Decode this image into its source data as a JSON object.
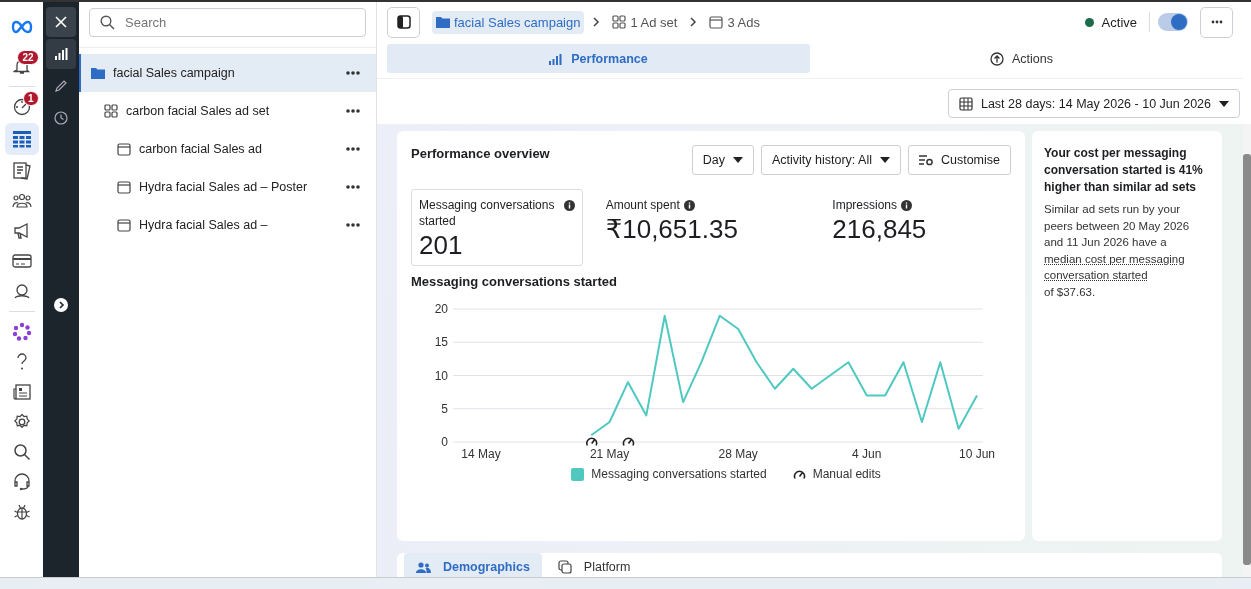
{
  "rail": [
    {
      "kind": "logo",
      "selected": false
    },
    {
      "kind": "bell",
      "selected": false,
      "badge": "22"
    },
    {
      "kind": "gauge",
      "selected": false,
      "badge": "1"
    },
    {
      "kind": "table",
      "selected": true
    },
    {
      "kind": "pages",
      "selected": false
    },
    {
      "kind": "people",
      "selected": false
    },
    {
      "kind": "megaphone",
      "selected": false
    },
    {
      "kind": "card",
      "selected": false
    },
    {
      "kind": "person",
      "selected": false
    },
    {
      "kind": "flower",
      "selected": false
    },
    {
      "kind": "help",
      "selected": false
    },
    {
      "kind": "news",
      "selected": false
    },
    {
      "kind": "settings",
      "selected": false
    },
    {
      "kind": "search",
      "selected": false
    },
    {
      "kind": "headset",
      "selected": false
    },
    {
      "kind": "bug",
      "selected": false
    }
  ],
  "tools": [
    {
      "kind": "chart",
      "selected": true
    },
    {
      "kind": "pencil",
      "selected": false
    },
    {
      "kind": "clock",
      "selected": false
    }
  ],
  "tree": {
    "search": {
      "placeholder": "Search"
    },
    "items": [
      {
        "kind": "campaign",
        "label": "facial Sales campaign",
        "selected": true,
        "children": [
          {
            "kind": "adset",
            "label": "carbon facial Sales ad set",
            "selected": false,
            "children": [
              {
                "kind": "ad",
                "label": "carbon facial Sales ad",
                "selected": false
              },
              {
                "kind": "ad",
                "label": "Hydra facial Sales ad – Poster",
                "selected": false
              },
              {
                "kind": "ad",
                "label": "Hydra facial Sales ad –",
                "selected": false
              }
            ]
          }
        ]
      }
    ]
  },
  "breadcrumb": [
    {
      "kind": "campaign",
      "label": "facial Sales campaign",
      "selected": true
    },
    {
      "kind": "adset",
      "label": "1 Ad set",
      "selected": false
    },
    {
      "kind": "ad",
      "label": "3 Ads",
      "selected": false
    }
  ],
  "status": {
    "label": "Active",
    "color": "#1e6b4a",
    "on": true
  },
  "tabs": [
    {
      "kind": "chart",
      "label": "Performance",
      "selected": true
    },
    {
      "kind": "actions",
      "label": "Actions",
      "selected": false
    }
  ],
  "date_range": "Last 28 days: 14 May 2026 - 10 Jun 2026",
  "overview": {
    "title": "Performance overview",
    "controls": [
      {
        "kind": "dropdown",
        "label": "Day"
      },
      {
        "kind": "dropdown",
        "label": "Activity history: All"
      },
      {
        "kind": "customise",
        "label": "Customise"
      }
    ],
    "metrics": [
      {
        "label": "Messaging conversations started",
        "value": "201",
        "selected": true
      },
      {
        "label": "Amount spent",
        "value": "₹10,651.35",
        "selected": false
      },
      {
        "label": "Impressions",
        "value": "216,845",
        "selected": false
      }
    ],
    "chart_title": "Messaging conversations started",
    "chart_data": {
      "type": "line",
      "categories": [
        "14 May",
        null,
        null,
        null,
        null,
        null,
        null,
        "21 May",
        null,
        null,
        null,
        null,
        null,
        null,
        "28 May",
        null,
        null,
        null,
        null,
        null,
        null,
        "4 Jun",
        null,
        null,
        null,
        null,
        null,
        "10 Jun"
      ],
      "ylim": [
        0,
        20
      ],
      "yticks": [
        0,
        5,
        10,
        15,
        20
      ],
      "series": [
        {
          "name": "Messaging conversations started",
          "color": "#4fc9bf",
          "values": [
            null,
            null,
            null,
            null,
            null,
            null,
            1,
            3,
            9,
            4,
            19,
            6,
            12,
            19,
            17,
            12,
            8,
            11,
            8,
            10,
            12,
            7,
            7,
            12,
            3,
            12,
            2,
            7
          ]
        }
      ],
      "grid": true
    },
    "manual_edits": [
      false,
      false,
      false,
      false,
      false,
      false,
      true,
      false,
      true,
      false,
      false,
      false,
      false,
      false,
      false,
      false,
      false,
      false,
      false,
      false,
      false,
      false,
      false,
      false,
      false,
      false,
      false,
      false
    ],
    "manual_edits_label": "Manual edits"
  },
  "insight": {
    "title": "Your cost per messaging conversation started is 41% higher than similar ad sets",
    "text_before": "Similar ad sets run by your peers between 20 May 2026 and 11 Jun 2026 have a",
    "link": "median cost per messaging conversation started",
    "text_after": "of $37.63."
  },
  "bottom_tabs": [
    {
      "kind": "people",
      "label": "Demographics",
      "selected": true
    },
    {
      "kind": "platform",
      "label": "Platform",
      "selected": false
    }
  ]
}
